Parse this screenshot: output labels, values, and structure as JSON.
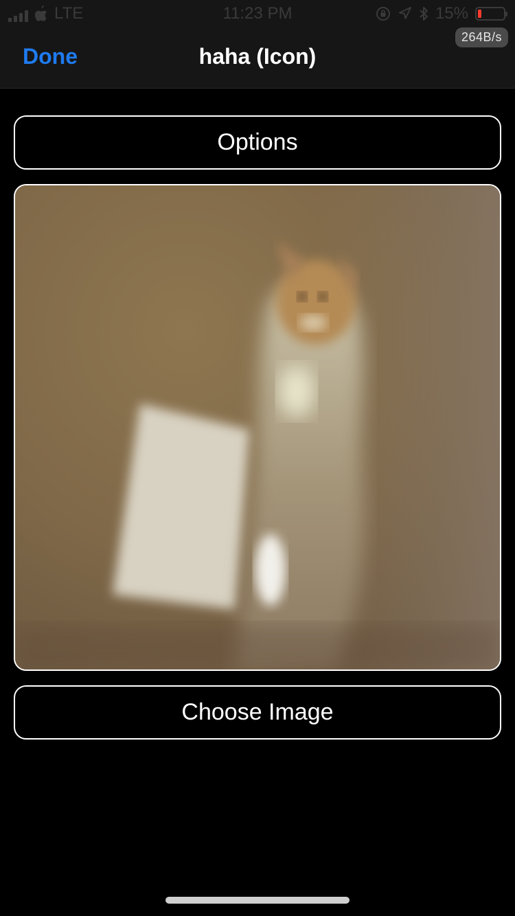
{
  "status_bar": {
    "carrier": "LTE",
    "time": "11:23 PM",
    "battery_percent": "15%",
    "battery_level": 0.15,
    "icons": [
      "signal-icon",
      "apple-icon",
      "orientation-lock-icon",
      "location-icon",
      "bluetooth-icon",
      "battery-icon"
    ]
  },
  "nav": {
    "done_label": "Done",
    "title": "haha (Icon)",
    "speed_badge": "264B/s"
  },
  "content": {
    "options_label": "Options",
    "choose_image_label": "Choose Image"
  },
  "colors": {
    "background": "#000000",
    "bar": "#161616",
    "accent": "#1f7bf0",
    "battery_low": "#ff3b30",
    "button_border": "#ffffff"
  }
}
